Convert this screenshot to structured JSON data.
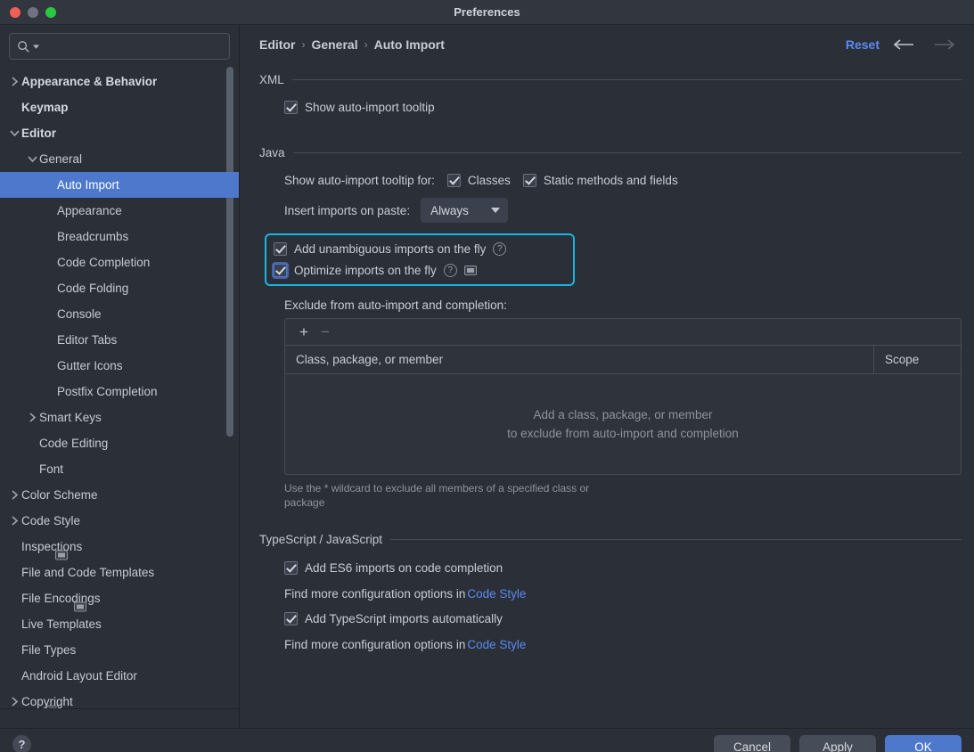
{
  "window": {
    "title": "Preferences",
    "traffic": {
      "close": "close-button",
      "minimize": "minimize-button",
      "maximize": "maximize-button"
    }
  },
  "search": {
    "value": "",
    "placeholder": ""
  },
  "sidebar": {
    "items": [
      {
        "label": "Appearance & Behavior",
        "indent": 0,
        "twisty": "collapsed",
        "bold": true,
        "selected": false,
        "badge": false
      },
      {
        "label": "Keymap",
        "indent": 0,
        "twisty": "none",
        "bold": true,
        "selected": false,
        "badge": false
      },
      {
        "label": "Editor",
        "indent": 0,
        "twisty": "expanded",
        "bold": true,
        "selected": false,
        "badge": false
      },
      {
        "label": "General",
        "indent": 1,
        "twisty": "expanded",
        "bold": false,
        "selected": false,
        "badge": false
      },
      {
        "label": "Auto Import",
        "indent": 2,
        "twisty": "none",
        "bold": false,
        "selected": true,
        "badge": false
      },
      {
        "label": "Appearance",
        "indent": 2,
        "twisty": "none",
        "bold": false,
        "selected": false,
        "badge": false
      },
      {
        "label": "Breadcrumbs",
        "indent": 2,
        "twisty": "none",
        "bold": false,
        "selected": false,
        "badge": false
      },
      {
        "label": "Code Completion",
        "indent": 2,
        "twisty": "none",
        "bold": false,
        "selected": false,
        "badge": false
      },
      {
        "label": "Code Folding",
        "indent": 2,
        "twisty": "none",
        "bold": false,
        "selected": false,
        "badge": false
      },
      {
        "label": "Console",
        "indent": 2,
        "twisty": "none",
        "bold": false,
        "selected": false,
        "badge": false
      },
      {
        "label": "Editor Tabs",
        "indent": 2,
        "twisty": "none",
        "bold": false,
        "selected": false,
        "badge": false
      },
      {
        "label": "Gutter Icons",
        "indent": 2,
        "twisty": "none",
        "bold": false,
        "selected": false,
        "badge": false
      },
      {
        "label": "Postfix Completion",
        "indent": 2,
        "twisty": "none",
        "bold": false,
        "selected": false,
        "badge": false
      },
      {
        "label": "Smart Keys",
        "indent": 1,
        "twisty": "collapsed",
        "bold": false,
        "selected": false,
        "badge": false
      },
      {
        "label": "Code Editing",
        "indent": 1,
        "twisty": "none",
        "bold": false,
        "selected": false,
        "badge": false
      },
      {
        "label": "Font",
        "indent": 1,
        "twisty": "none",
        "bold": false,
        "selected": false,
        "badge": false
      },
      {
        "label": "Color Scheme",
        "indent": 0,
        "twisty": "collapsed",
        "bold": false,
        "selected": false,
        "badge": false
      },
      {
        "label": "Code Style",
        "indent": 0,
        "twisty": "collapsed",
        "bold": false,
        "selected": false,
        "badge": false
      },
      {
        "label": "Inspections",
        "indent": 0,
        "twisty": "none",
        "bold": false,
        "selected": false,
        "badge": true
      },
      {
        "label": "File and Code Templates",
        "indent": 0,
        "twisty": "none",
        "bold": false,
        "selected": false,
        "badge": false
      },
      {
        "label": "File Encodings",
        "indent": 0,
        "twisty": "none",
        "bold": false,
        "selected": false,
        "badge": true
      },
      {
        "label": "Live Templates",
        "indent": 0,
        "twisty": "none",
        "bold": false,
        "selected": false,
        "badge": false
      },
      {
        "label": "File Types",
        "indent": 0,
        "twisty": "none",
        "bold": false,
        "selected": false,
        "badge": false
      },
      {
        "label": "Android Layout Editor",
        "indent": 0,
        "twisty": "none",
        "bold": false,
        "selected": false,
        "badge": false
      },
      {
        "label": "Copyright",
        "indent": 0,
        "twisty": "collapsed",
        "bold": false,
        "selected": false,
        "badge": true
      }
    ]
  },
  "header": {
    "breadcrumb": [
      "Editor",
      "General",
      "Auto Import"
    ],
    "separator": "›",
    "reset_label": "Reset",
    "back_arrow": "←",
    "forward_arrow": "→"
  },
  "sections": {
    "xml": {
      "title": "XML",
      "show_tooltip": {
        "label": "Show auto-import tooltip",
        "checked": true
      }
    },
    "java": {
      "title": "Java",
      "tooltip_for_label": "Show auto-import tooltip for:",
      "tooltip_classes": {
        "label": "Classes",
        "checked": true
      },
      "tooltip_static": {
        "label": "Static methods and fields",
        "checked": true
      },
      "insert_label": "Insert imports on paste:",
      "insert_value": "Always",
      "highlight_color": "#18b6e0",
      "add_unambiguous": {
        "label": "Add unambiguous imports on the fly",
        "checked": true,
        "focused": false
      },
      "optimize_imports": {
        "label": "Optimize imports on the fly",
        "checked": true,
        "focused": true
      },
      "exclude_label": "Exclude from auto-import and completion:",
      "add_button": "+",
      "remove_button": "−",
      "columns": [
        "Class, package, or member",
        "Scope"
      ],
      "empty_line1": "Add a class, package, or member",
      "empty_line2": "to exclude from auto-import and completion",
      "hint": "Use the * wildcard to exclude all members of a specified class or package"
    },
    "tsjs": {
      "title": "TypeScript / JavaScript",
      "es6": {
        "label": "Add ES6 imports on code completion",
        "checked": true
      },
      "find_more_1_prefix": "Find more configuration options in ",
      "find_more_1_link": "Code Style",
      "ts_auto": {
        "label": "Add TypeScript imports automatically",
        "checked": true
      },
      "find_more_2_prefix": "Find more configuration options in ",
      "find_more_2_link": "Code Style"
    }
  },
  "footer": {
    "help_label": "?",
    "cancel_label": "Cancel",
    "apply_label": "Apply",
    "ok_label": "OK"
  },
  "colors": {
    "accent_blue": "#4d78cc",
    "link_blue": "#5b8bf0",
    "highlight_cyan": "#18b6e0",
    "background": "#2b2f38"
  }
}
